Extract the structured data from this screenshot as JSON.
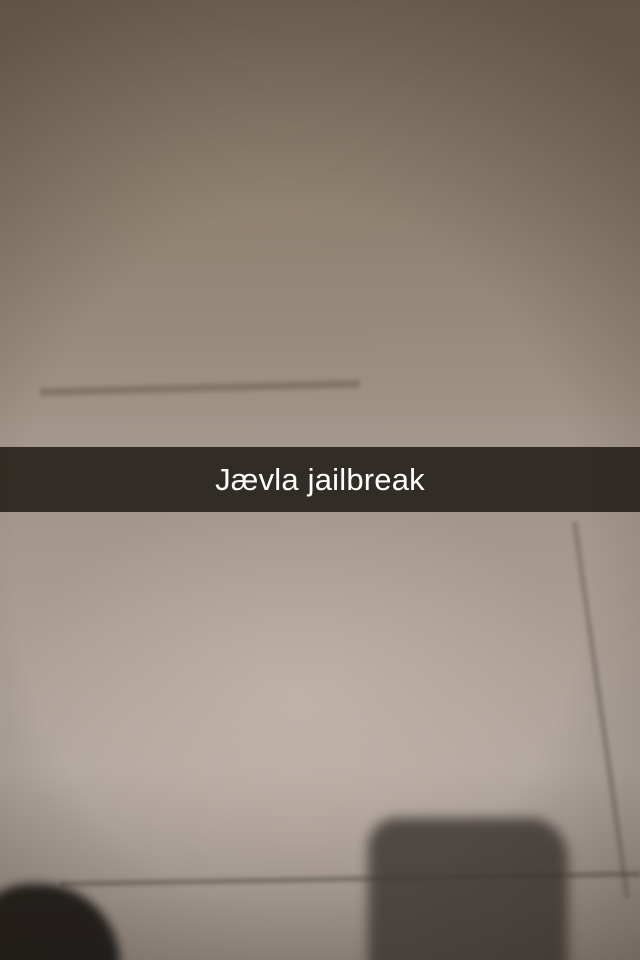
{
  "snap": {
    "caption": "Jævla jailbreak"
  },
  "colors": {
    "caption_bar": "#26201b",
    "caption_text": "#ffffff"
  }
}
